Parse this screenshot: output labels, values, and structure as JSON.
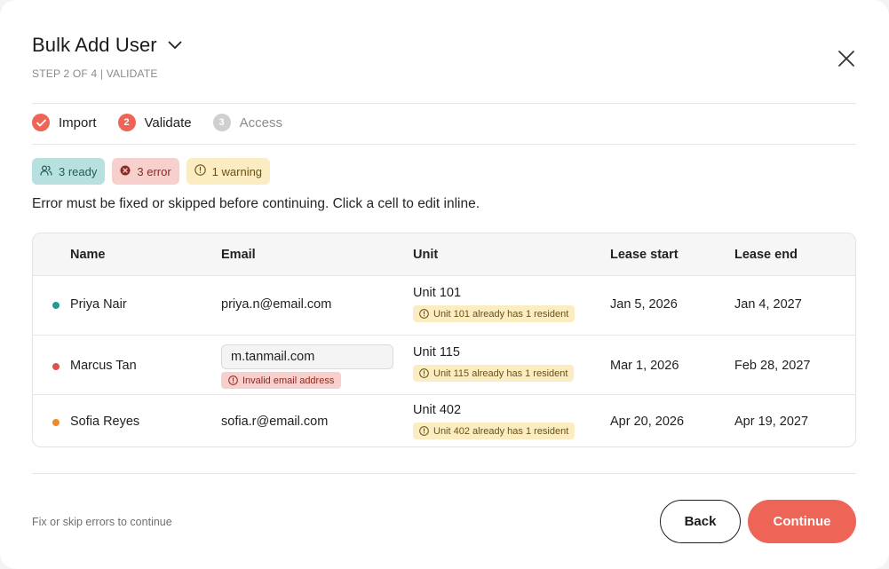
{
  "header": {
    "title": "Bulk Add User",
    "subtitle": "STEP 2 OF 4 | VALIDATE"
  },
  "steps": [
    {
      "label": "Import",
      "state": "done",
      "icon": "check-icon"
    },
    {
      "label": "Validate",
      "state": "active",
      "number": "2"
    },
    {
      "label": "Access",
      "state": "todo",
      "number": "3"
    }
  ],
  "badges": {
    "ready": "3 ready",
    "error": "3 error",
    "warning": "1 warning"
  },
  "instructions": "Error must be fixed or skipped before continuing. Click a cell to edit inline.",
  "table": {
    "headers": {
      "name": "Name",
      "email": "Email",
      "unit": "Unit",
      "lease_start": "Lease start",
      "lease_end": "Lease end"
    },
    "rows": [
      {
        "status_color": "#1f9b96",
        "name": "Priya Nair",
        "email": "priya.n@email.com",
        "unit": "Unit 101",
        "unit_warning": "Unit 101 already has 1 resident",
        "lease_start": "Jan 5, 2026",
        "lease_end": "Jan 4, 2027"
      },
      {
        "status_color": "#e0524a",
        "name": "Marcus Tan",
        "email": "m.tanmail.com",
        "email_error": "Invalid email address",
        "unit": "Unit 115",
        "unit_warning": "Unit 115 already has 1 resident",
        "lease_start": "Mar 1, 2026",
        "lease_end": "Feb 28, 2027"
      },
      {
        "status_color": "#ec8a2c",
        "name": "Sofia Reyes",
        "email": "sofia.r@email.com",
        "unit": "Unit 402",
        "unit_warning": "Unit 402 already has 1 resident",
        "lease_start": "Apr 20, 2026",
        "lease_end": "Apr 19, 2027"
      }
    ]
  },
  "footer": {
    "note": "Fix or skip errors to continue",
    "back_label": "Back",
    "continue_label": "Continue"
  },
  "colors": {
    "accent": "#ee6457",
    "ready_bg": "#b8e0df",
    "error_bg": "#f7cfcc",
    "warning_bg": "#fbecc2"
  }
}
